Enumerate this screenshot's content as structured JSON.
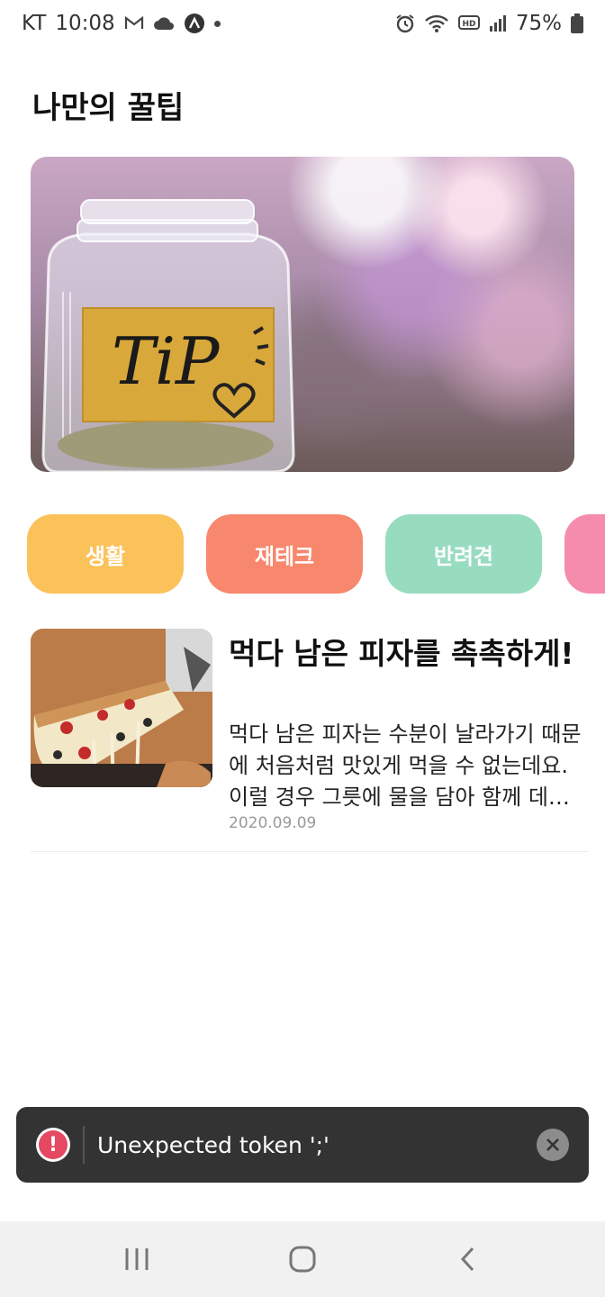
{
  "status_bar": {
    "carrier": "KT",
    "time": "10:08",
    "battery": "75%",
    "icons": [
      "mail-icon",
      "cloud-icon",
      "app-icon",
      "alarm-icon",
      "wifi-icon",
      "hd-icon",
      "signal-icon",
      "battery-icon"
    ]
  },
  "header": {
    "title": "나만의 꿀팁"
  },
  "hero": {
    "image_subject": "tip-jar",
    "jar_label": "TiP"
  },
  "categories": [
    {
      "label": "생활",
      "color": "#fbc25a"
    },
    {
      "label": "재테크",
      "color": "#f7886d"
    },
    {
      "label": "반려견",
      "color": "#98dcc0"
    },
    {
      "label": "",
      "color": "#f58cab"
    }
  ],
  "article": {
    "title": "먹다 남은 피자를 촉촉하게!",
    "description": "먹다 남은 피자는 수분이 날라가기 때문에 처음처럼 맛있게 먹을 수 없는데요. 이럴 경우 그릇에 물을 담아 함께 데워주세요.",
    "date": "2020.09.09",
    "thumbnail": "pizza-image"
  },
  "toast": {
    "message": "Unexpected token ';'",
    "alert_glyph": "!"
  },
  "colors": {
    "toast_bg": "#333333",
    "alert_red": "#e54862",
    "date_gray": "#9a9a9a"
  }
}
